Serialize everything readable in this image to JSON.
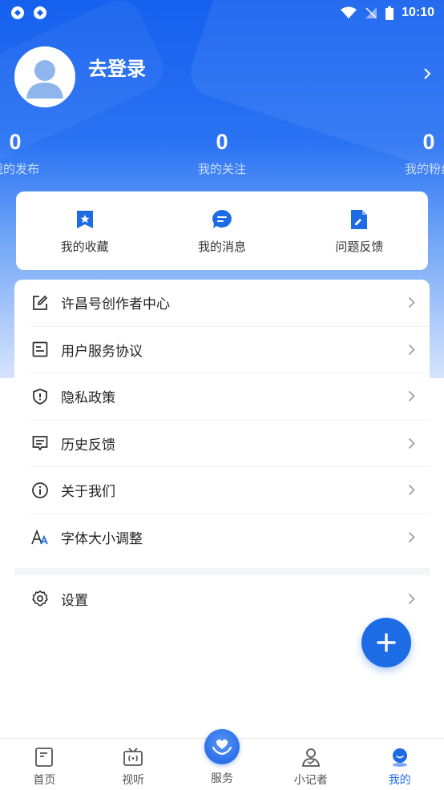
{
  "status_bar": {
    "time": "10:10"
  },
  "profile": {
    "login_text": "去登录"
  },
  "stats": [
    {
      "value": "0",
      "label": "我的发布"
    },
    {
      "value": "0",
      "label": "我的关注"
    },
    {
      "value": "0",
      "label": "我的粉丝"
    }
  ],
  "quick_actions": [
    {
      "label": "我的收藏",
      "icon": "star-bookmark-icon"
    },
    {
      "label": "我的消息",
      "icon": "message-bubble-icon"
    },
    {
      "label": "问题反馈",
      "icon": "feedback-doc-icon"
    }
  ],
  "menu": [
    {
      "label": "许昌号创作者中心",
      "icon": "edit-square-icon"
    },
    {
      "label": "用户服务协议",
      "icon": "document-icon"
    },
    {
      "label": "隐私政策",
      "icon": "shield-icon"
    },
    {
      "label": "历史反馈",
      "icon": "comment-lines-icon"
    },
    {
      "label": "关于我们",
      "icon": "info-icon"
    },
    {
      "label": "字体大小调整",
      "icon": "font-size-icon"
    }
  ],
  "settings": {
    "label": "设置",
    "icon": "gear-icon"
  },
  "tabs": [
    {
      "label": "首页",
      "icon": "home-doc-icon"
    },
    {
      "label": "视听",
      "icon": "tv-icon"
    },
    {
      "label": "服务",
      "icon": "heart-hands-icon"
    },
    {
      "label": "小记者",
      "icon": "reporter-icon"
    },
    {
      "label": "我的",
      "icon": "me-icon"
    }
  ],
  "colors": {
    "primary": "#1e6be6",
    "hero_top": "#1560ee",
    "tab_inactive": "#555555"
  }
}
